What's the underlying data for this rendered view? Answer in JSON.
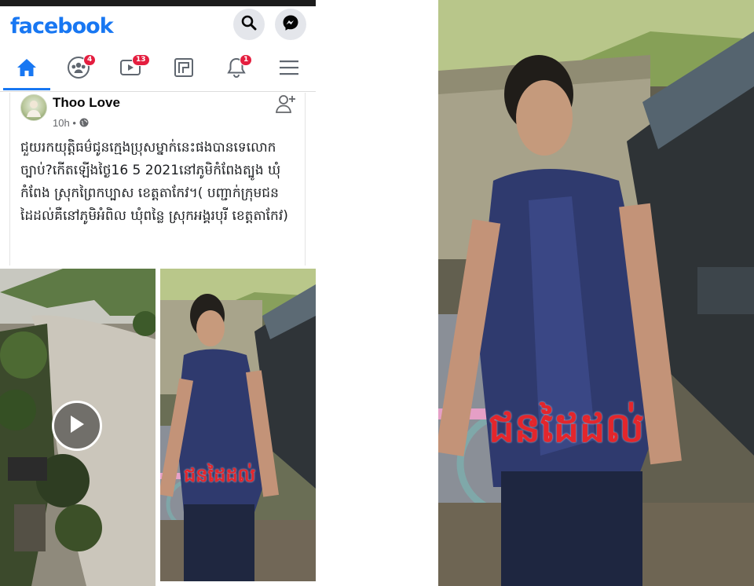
{
  "app": {
    "logo_text": "facebook",
    "brand_color": "#1877f2"
  },
  "header": {
    "icons": [
      "search-icon",
      "messenger-icon"
    ]
  },
  "navbar": {
    "items": [
      {
        "name": "home",
        "icon": "home-icon",
        "badge": ""
      },
      {
        "name": "groups",
        "icon": "groups-icon",
        "badge": "4"
      },
      {
        "name": "watch",
        "icon": "watch-icon",
        "badge": "13"
      },
      {
        "name": "pages",
        "icon": "pages-icon",
        "badge": ""
      },
      {
        "name": "notifications",
        "icon": "bell-icon",
        "badge": "1"
      },
      {
        "name": "menu",
        "icon": "hamburger-icon",
        "badge": ""
      }
    ]
  },
  "post": {
    "author": "Thoo Love",
    "time": "10h",
    "privacy_icon": "globe-icon",
    "text": "ជួយរកយុត្តិធម៌ជូនក្មេងប្រុសម្នាក់នេះផងបានទេលោកច្បាប់?កើតឡើងថ្ងៃ16  5  2021នៅភូមិកំពែងត្បូង ឃុំកំពែង ស្រុកព្រៃកប្បាស ខេត្តតាកែវ។( បញ្ជាក់ក្រុមជនដៃដល់គឺនៅភូមិអំពិល ឃុំពន្លៃ ស្រុកអង្គរបុរី ខេត្តតាកែវ)",
    "photo_caption": "ជនដៃដល់"
  },
  "big_photo": {
    "caption": "ជនដៃដល់"
  },
  "colors": {
    "badge_red": "#e41e3f",
    "caption_red": "#e3262c"
  }
}
